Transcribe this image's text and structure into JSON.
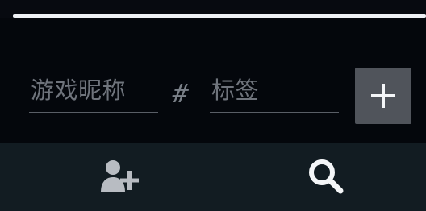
{
  "form": {
    "nickname": {
      "placeholder": "游戏昵称",
      "value": ""
    },
    "separator": "#",
    "tag": {
      "placeholder": "标签",
      "value": ""
    },
    "add_button_icon": "plus-icon"
  },
  "bottom_bar": {
    "tabs": [
      {
        "icon": "add-friend-icon"
      },
      {
        "icon": "search-icon"
      }
    ]
  },
  "colors": {
    "background": "#070a10",
    "panel": "#04070c",
    "accent_line": "#eef1f5",
    "underline": "#595e66",
    "placeholder": "#6f747c",
    "add_button_bg": "#50545b",
    "bottom_bar_bg": "#121c22",
    "icon_muted": "#b8bcc2",
    "icon_light": "#f4f6f8"
  }
}
